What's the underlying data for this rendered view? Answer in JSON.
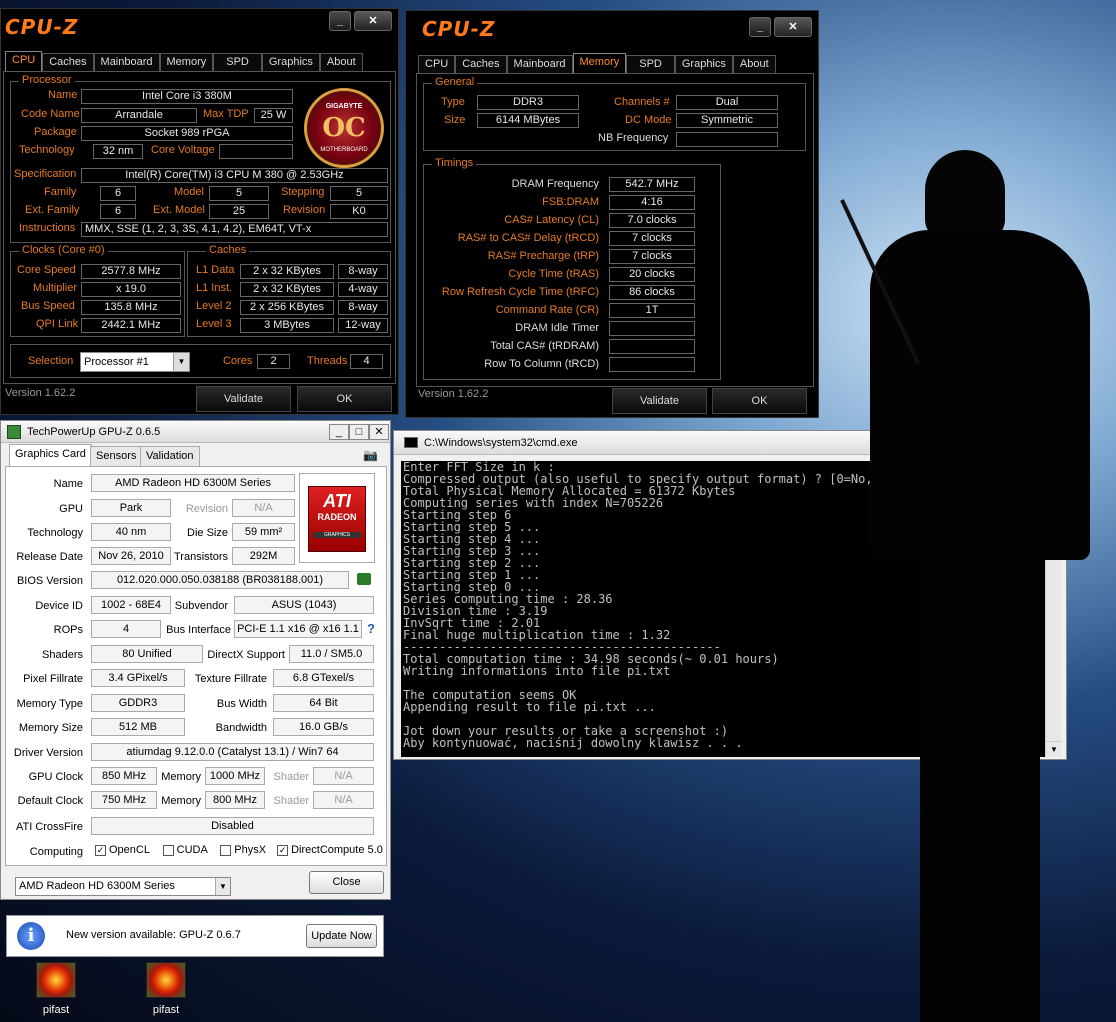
{
  "cpuz_left": {
    "logo": "CPU-Z",
    "tabs": [
      "CPU",
      "Caches",
      "Mainboard",
      "Memory",
      "SPD",
      "Graphics",
      "About"
    ],
    "processor": {
      "group": "Processor",
      "name_label": "Name",
      "name": "Intel Core i3 380M",
      "code_label": "Code Name",
      "code": "Arrandale",
      "tdp_label": "Max TDP",
      "tdp": "25 W",
      "package_label": "Package",
      "package": "Socket 989 rPGA",
      "tech_label": "Technology",
      "tech": "32 nm",
      "voltage_label": "Core Voltage",
      "voltage": "",
      "spec_label": "Specification",
      "spec": "Intel(R) Core(TM) i3 CPU       M 380  @ 2.53GHz",
      "family_label": "Family",
      "family": "6",
      "model_label": "Model",
      "model": "5",
      "stepping_label": "Stepping",
      "stepping": "5",
      "extfam_label": "Ext. Family",
      "extfam": "6",
      "extmodel_label": "Ext. Model",
      "extmodel": "25",
      "revision_label": "Revision",
      "revision": "K0",
      "instr_label": "Instructions",
      "instr": "MMX, SSE (1, 2, 3, 3S, 4.1, 4.2), EM64T, VT-x",
      "badge_oc": "OC",
      "badge_top": "GIGABYTE",
      "badge_bottom": "MOTHERBOARD"
    },
    "clocks": {
      "group": "Clocks (Core #0)",
      "core_label": "Core Speed",
      "core": "2577.8 MHz",
      "mult_label": "Multiplier",
      "mult": "x 19.0",
      "bus_label": "Bus Speed",
      "bus": "135.8 MHz",
      "qpi_label": "QPI Link",
      "qpi": "2442.1 MHz"
    },
    "caches": {
      "group": "Caches",
      "l1d_label": "L1 Data",
      "l1d": "2 x 32 KBytes",
      "l1d_way": "8-way",
      "l1i_label": "L1 Inst.",
      "l1i": "2 x 32 KBytes",
      "l1i_way": "4-way",
      "l2_label": "Level 2",
      "l2": "2 x 256 KBytes",
      "l2_way": "8-way",
      "l3_label": "Level 3",
      "l3": "3 MBytes",
      "l3_way": "12-way"
    },
    "selection_label": "Selection",
    "selection": "Processor #1",
    "cores_label": "Cores",
    "cores": "2",
    "threads_label": "Threads",
    "threads": "4",
    "version": "Version 1.62.2",
    "validate": "Validate",
    "ok": "OK",
    "min": "_",
    "close": "✕"
  },
  "cpuz_right": {
    "logo": "CPU-Z",
    "tabs": [
      "CPU",
      "Caches",
      "Mainboard",
      "Memory",
      "SPD",
      "Graphics",
      "About"
    ],
    "general": {
      "group": "General",
      "type_label": "Type",
      "type": "DDR3",
      "size_label": "Size",
      "size": "6144 MBytes",
      "channels_label": "Channels #",
      "channels": "Dual",
      "dc_label": "DC Mode",
      "dc": "Symmetric",
      "nb_label": "NB Frequency",
      "nb": ""
    },
    "timings": {
      "group": "Timings",
      "rows": [
        {
          "label": "DRAM Frequency",
          "value": "542.7 MHz",
          "white": true
        },
        {
          "label": "FSB:DRAM",
          "value": "4:16",
          "white": false
        },
        {
          "label": "CAS# Latency (CL)",
          "value": "7.0 clocks",
          "white": false
        },
        {
          "label": "RAS# to CAS# Delay (tRCD)",
          "value": "7 clocks",
          "white": false
        },
        {
          "label": "RAS# Precharge (tRP)",
          "value": "7 clocks",
          "white": false
        },
        {
          "label": "Cycle Time (tRAS)",
          "value": "20 clocks",
          "white": false
        },
        {
          "label": "Row Refresh Cycle Time (tRFC)",
          "value": "86 clocks",
          "white": false
        },
        {
          "label": "Command Rate (CR)",
          "value": "1T",
          "white": false
        },
        {
          "label": "DRAM Idle Timer",
          "value": "",
          "white": true
        },
        {
          "label": "Total CAS# (tRDRAM)",
          "value": "",
          "white": true
        },
        {
          "label": "Row To Column (tRCD)",
          "value": "",
          "white": true
        }
      ]
    },
    "version": "Version 1.62.2",
    "validate": "Validate",
    "ok": "OK",
    "min": "_",
    "close": "✕"
  },
  "gpuz": {
    "title": "TechPowerUp GPU-Z 0.6.5",
    "tabs": [
      "Graphics Card",
      "Sensors",
      "Validation"
    ],
    "name_label": "Name",
    "name": "AMD Radeon HD 6300M Series",
    "gpu_label": "GPU",
    "gpu": "Park",
    "revision_label": "Revision",
    "revision": "N/A",
    "tech_label": "Technology",
    "tech": "40 nm",
    "die_label": "Die Size",
    "die": "59 mm²",
    "release_label": "Release Date",
    "release": "Nov 26, 2010",
    "trans_label": "Transistors",
    "trans": "292M",
    "bios_label": "BIOS Version",
    "bios": "012.020.000.050.038188 (BR038188.001)",
    "devid_label": "Device ID",
    "devid": "1002 - 68E4",
    "subv_label": "Subvendor",
    "subv": "ASUS (1043)",
    "rops_label": "ROPs",
    "rops": "4",
    "busif_label": "Bus Interface",
    "busif": "PCI-E 1.1 x16 @ x16 1.1",
    "shaders_label": "Shaders",
    "shaders": "80 Unified",
    "dx_label": "DirectX Support",
    "dx": "11.0 / SM5.0",
    "pixel_label": "Pixel Fillrate",
    "pixel": "3.4 GPixel/s",
    "texture_label": "Texture Fillrate",
    "texture": "6.8 GTexel/s",
    "memtype_label": "Memory Type",
    "memtype": "GDDR3",
    "buswidth_label": "Bus Width",
    "buswidth": "64 Bit",
    "memsize_label": "Memory Size",
    "memsize": "512 MB",
    "bandwidth_label": "Bandwidth",
    "bandwidth": "16.0 GB/s",
    "driver_label": "Driver Version",
    "driver": "atiumdag 9.12.0.0 (Catalyst 13.1) / Win7 64",
    "gpuclock_label": "GPU Clock",
    "gpuclock": "850 MHz",
    "mem_label": "Memory",
    "memclock": "1000 MHz",
    "shader_label": "Shader",
    "shader": "N/A",
    "defclock_label": "Default Clock",
    "defclock": "750 MHz",
    "defmem": "800 MHz",
    "defshader": "N/A",
    "crossfire_label": "ATI CrossFire",
    "crossfire": "Disabled",
    "computing_label": "Computing",
    "opencl": "OpenCL",
    "cuda": "CUDA",
    "physx": "PhysX",
    "dc": "DirectCompute 5.0",
    "device_select": "AMD Radeon HD 6300M Series",
    "close": "Close",
    "logo_top": "ATI",
    "logo_mid": "RADEON",
    "logo_bot": "GRAPHICS"
  },
  "cmd": {
    "title": "C:\\Windows\\system32\\cmd.exe",
    "lines": [
      "Enter FFT Size in k :",
      "Compressed output (also useful to specify output format) ? [0=No, 1=Yes] :",
      "Total Physical Memory Allocated = 61372 Kbytes",
      "Computing series with index N=705226",
      "Starting step 6",
      "Starting step 5 ...",
      "Starting step 4 ...",
      "Starting step 3 ...",
      "Starting step 2 ...",
      "Starting step 1 ...",
      "Starting step 0 ...",
      "Series computing time : 28.36",
      "Division time : 3.19",
      "InvSqrt time : 2.01",
      "Final huge multiplication time : 1.32",
      "--------------------------------------------",
      "Total computation time : 34.98 seconds(~ 0.01 hours)",
      "Writing informations into file pi.txt",
      "",
      "The computation seems OK",
      "Appending result to file pi.txt ...",
      "",
      "Jot down your results or take a screenshot :)",
      "Aby kontynuować, naciśnij dowolny klawisz . . ."
    ]
  },
  "notify": {
    "text": "New version available: GPU-Z 0.6.7",
    "button": "Update Now"
  },
  "desktop": {
    "icons": [
      "pifast",
      "pifast"
    ]
  }
}
